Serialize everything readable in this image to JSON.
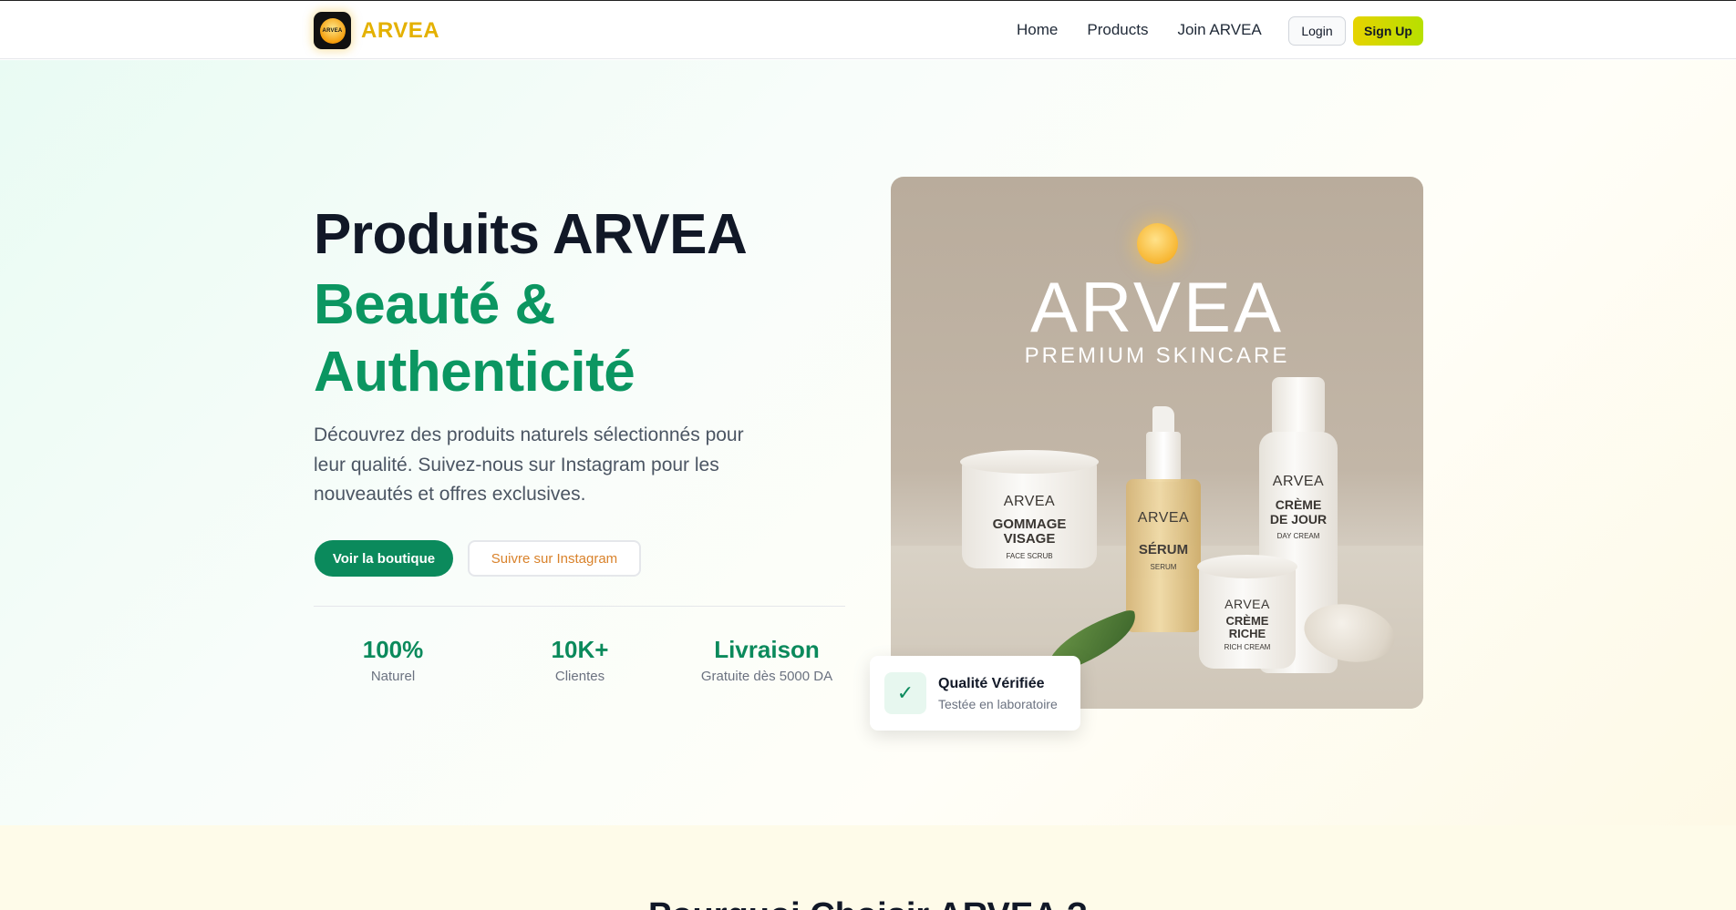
{
  "header": {
    "logo_text": "ARVEA",
    "logo_badge_text": "ARVEA",
    "nav": [
      "Home",
      "Products",
      "Join ARVEA"
    ],
    "login_label": "Login",
    "signup_label": "Sign Up"
  },
  "hero": {
    "title_line1": "Produits ARVEA",
    "title_line2": "Beauté &",
    "title_line3": "Authenticité",
    "description": "Découvrez des produits naturels sélectionnés pour leur qualité. Suivez-nous sur Instagram pour les nouveautés et offres exclusives.",
    "primary_cta": "Voir la boutique",
    "secondary_cta": "Suivre sur Instagram",
    "stats": [
      {
        "value": "100%",
        "label": "Naturel"
      },
      {
        "value": "10K+",
        "label": "Clientes"
      },
      {
        "value": "Livraison",
        "label": "Gratuite dès 5000 DA"
      }
    ]
  },
  "product_image": {
    "brand": "ARVEA",
    "tagline": "PREMIUM SKINCARE",
    "products": [
      {
        "brand": "ARVEA",
        "name": "GOMMAGE VISAGE",
        "subtitle": "FACE SCRUB"
      },
      {
        "brand": "ARVEA",
        "name": "SÉRUM",
        "subtitle": "SERUM"
      },
      {
        "brand": "ARVEA",
        "name": "CRÈME DE JOUR",
        "subtitle": "DAY CREAM"
      },
      {
        "brand": "ARVEA",
        "name": "CRÈME RICHE",
        "subtitle": "RICH CREAM"
      }
    ]
  },
  "quality_card": {
    "title": "Qualité Vérifiée",
    "subtitle": "Testée en laboratoire",
    "icon": "check-icon"
  },
  "next_section": {
    "title": "Pourquoi Choisir ARVEA ?"
  },
  "colors": {
    "accent_green": "#0b8a5c",
    "brand_yellow": "#e4b100",
    "signup_gradient": "#d6dc00"
  }
}
